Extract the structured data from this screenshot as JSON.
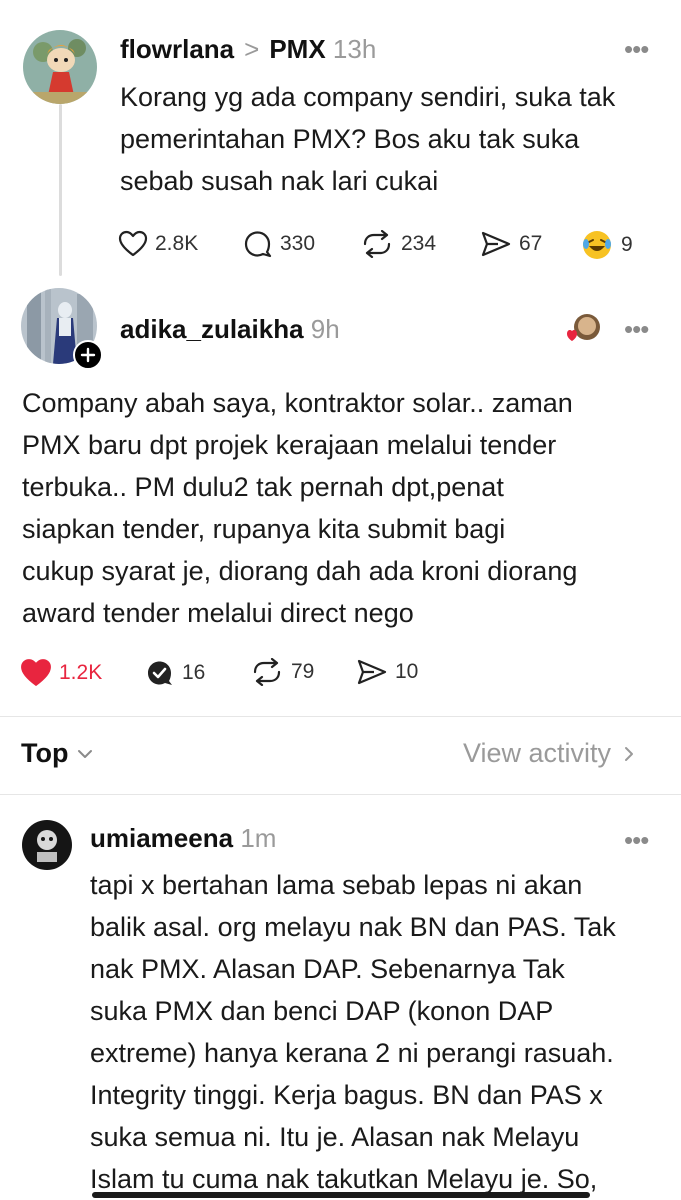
{
  "post1": {
    "username": "flowrlana",
    "separator": ">",
    "community": "PMX",
    "time": "13h",
    "text_lines": [
      "Korang yg ada company sendiri, suka tak",
      "pemerintahan PMX? Bos aku tak suka",
      "sebab susah nak lari cukai"
    ],
    "likes": "2.8K",
    "replies": "330",
    "reposts": "234",
    "shares": "67",
    "reactions": "9"
  },
  "post2": {
    "username": "adika_zulaikha",
    "time": "9h",
    "text_lines": [
      "Company abah saya, kontraktor solar.. zaman",
      "PMX baru dpt projek kerajaan melalui tender",
      "terbuka.. PM dulu2 tak pernah dpt,penat",
      "siapkan tender, rupanya kita submit bagi",
      "cukup syarat je, diorang dah ada kroni diorang",
      "award tender melalui direct nego"
    ],
    "likes": "1.2K",
    "replies": "16",
    "reposts": "79",
    "shares": "10"
  },
  "sort_bar": {
    "sort_label": "Top",
    "view_activity": "View activity"
  },
  "reply1": {
    "username": "umiameena",
    "time": "1m",
    "text_lines": [
      "tapi x bertahan lama sebab lepas ni akan",
      "balik asal. org melayu nak BN dan PAS. Tak",
      "nak PMX. Alasan DAP. Sebenarnya Tak",
      "suka PMX dan benci DAP (konon DAP",
      "extreme) hanya kerana 2 ni perangi rasuah.",
      "Integrity tinggi. Kerja bagus. BN dan PAS x",
      "suka semua ni. Itu je. Alasan nak Melayu",
      "Islam tu cuma nak takutkan Melayu je. So,"
    ]
  },
  "colors": {
    "like_active": "#e8253f",
    "muted": "#9a9a9a",
    "text": "#1a1a1a"
  },
  "icons": [
    "more-icon",
    "heart-icon",
    "reply-icon",
    "repost-icon",
    "share-icon",
    "laugh-emoji-icon",
    "plus-icon",
    "chevron-down-icon",
    "chevron-right-icon",
    "verified-reply-icon"
  ]
}
